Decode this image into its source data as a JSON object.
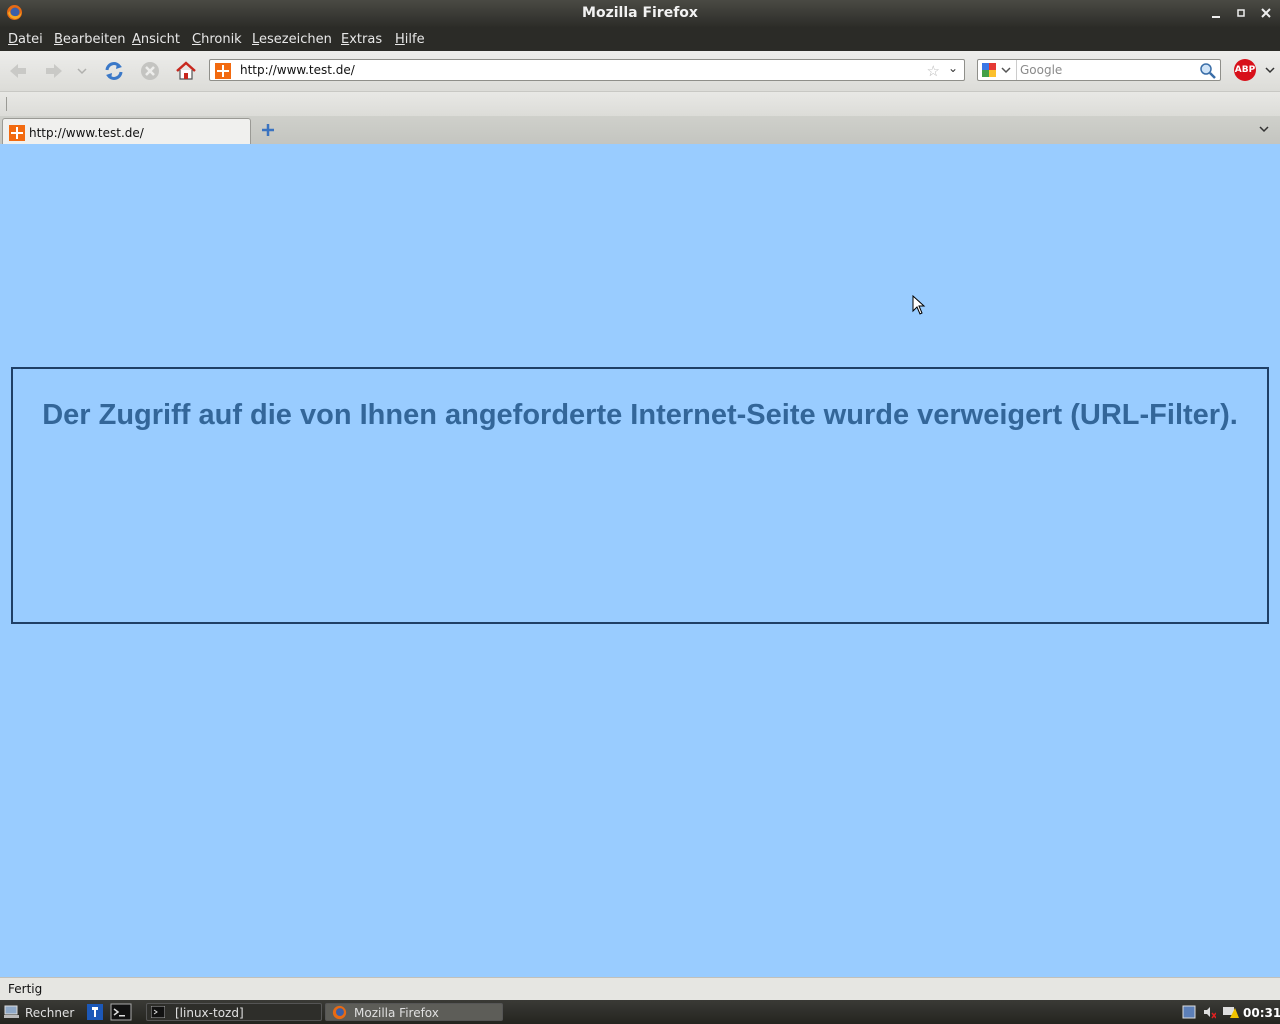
{
  "window": {
    "title": "Mozilla Firefox"
  },
  "menu": {
    "items": [
      "Datei",
      "Bearbeiten",
      "Ansicht",
      "Chronik",
      "Lesezeichen",
      "Extras",
      "Hilfe"
    ]
  },
  "urlbar": {
    "value": "http://www.test.de/"
  },
  "searchbar": {
    "placeholder": "Google"
  },
  "addons": {
    "abp_label": "ABP"
  },
  "tabs": [
    {
      "label": "http://www.test.de/"
    }
  ],
  "page": {
    "message": "Der Zugriff auf die von Ihnen angeforderte Internet-Seite wurde verweigert (URL-Filter).",
    "background": "#99ccff",
    "text_color": "#336699"
  },
  "status": {
    "text": "Fertig"
  },
  "taskbar": {
    "start_label": "Rechner",
    "tasks": [
      {
        "label": "[linux-tozd]"
      },
      {
        "label": "Mozilla Firefox"
      }
    ],
    "clock": "00:31"
  }
}
